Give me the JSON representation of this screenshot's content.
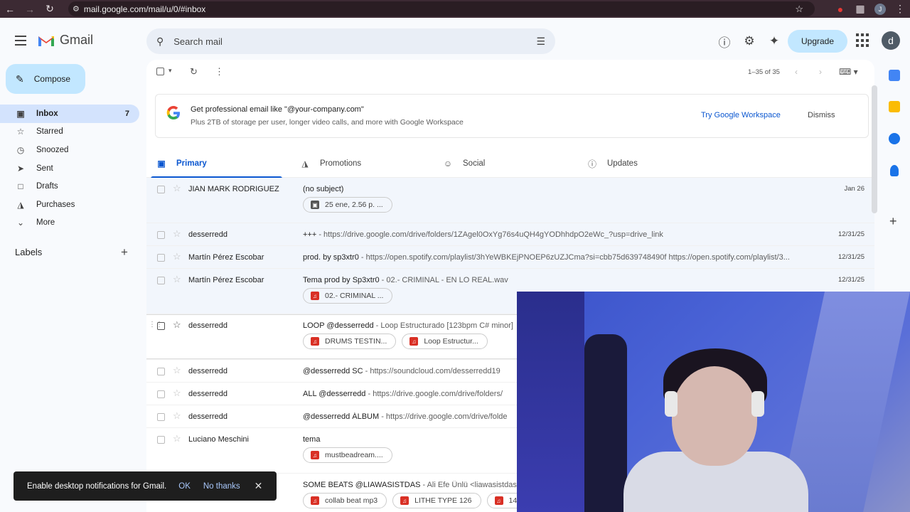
{
  "browser": {
    "url": "mail.google.com/mail/u/0/#inbox",
    "avatar_letter": "J"
  },
  "header": {
    "logo_text": "Gmail",
    "search_placeholder": "Search mail",
    "upgrade_label": "Upgrade",
    "avatar_letter": "d"
  },
  "sidebar": {
    "compose_label": "Compose",
    "items": [
      {
        "label": "Inbox",
        "icon": "inbox-icon",
        "count": "7",
        "active": true
      },
      {
        "label": "Starred",
        "icon": "star-icon",
        "count": ""
      },
      {
        "label": "Snoozed",
        "icon": "clock-icon",
        "count": ""
      },
      {
        "label": "Sent",
        "icon": "send-icon",
        "count": ""
      },
      {
        "label": "Drafts",
        "icon": "draft-icon",
        "count": ""
      },
      {
        "label": "Purchases",
        "icon": "tag-icon",
        "count": ""
      },
      {
        "label": "More",
        "icon": "chevron-down-icon",
        "count": ""
      }
    ],
    "labels_header": "Labels"
  },
  "toolbar": {
    "pager_text": "1–35 of 35"
  },
  "promo": {
    "title": "Get professional email like \"@your-company.com\"",
    "subtitle": "Plus 2TB of storage per user, longer video calls, and more with Google Workspace",
    "cta": "Try Google Workspace",
    "dismiss": "Dismiss"
  },
  "tabs": [
    {
      "label": "Primary",
      "icon": "inbox-tab-icon"
    },
    {
      "label": "Promotions",
      "icon": "tag-icon"
    },
    {
      "label": "Social",
      "icon": "people-icon"
    },
    {
      "label": "Updates",
      "icon": "info-icon"
    }
  ],
  "emails": [
    {
      "sender": "JIAN MARK RODRIGUEZ",
      "subject": "(no subject)",
      "snippet": "",
      "date": "Jan 26",
      "chips": [
        "25 ene, 2.56 p. ..."
      ]
    },
    {
      "sender": "desserredd",
      "subject": "+++",
      "snippet": " - https://drive.google.com/drive/folders/1ZAgel0OxYg76s4uQH4gYODhhdpO2eWc_?usp=drive_link",
      "date": "12/31/25",
      "chips": []
    },
    {
      "sender": "Martín Pérez Escobar",
      "subject": "prod. by sp3xtr0",
      "snippet": " - https://open.spotify.com/playlist/3hYeWBKEjPNOEP6zUZJCma?si=cbb75d639748490f https://open.spotify.com/playlist/3...",
      "date": "12/31/25",
      "chips": []
    },
    {
      "sender": "Martín Pérez Escobar",
      "subject": "Tema prod by Sp3xtr0",
      "snippet": " - 02.- CRIMINAL - EN LO REAL.wav",
      "date": "12/31/25",
      "chips": [
        "02.- CRIMINAL ..."
      ]
    },
    {
      "sender": "desserredd",
      "subject": "LOOP @desserredd",
      "snippet": " - Loop Estructurado [123bpm C# minor]",
      "date": "",
      "chips": [
        "DRUMS TESTIN...",
        "Loop Estructur..."
      ]
    },
    {
      "sender": "desserredd",
      "subject": "@desserredd SC",
      "snippet": " - https://soundcloud.com/desserredd19",
      "date": "",
      "chips": []
    },
    {
      "sender": "desserredd",
      "subject": "ALL @desserredd",
      "snippet": " - https://drive.google.com/drive/folders/",
      "date": "",
      "chips": []
    },
    {
      "sender": "desserredd",
      "subject": "@desserredd ÁLBUM",
      "snippet": " - https://drive.google.com/drive/folde",
      "date": "",
      "chips": []
    },
    {
      "sender": "Luciano Meschini",
      "subject": "tema",
      "snippet": "",
      "date": "",
      "chips": [
        "mustbeadream...."
      ]
    },
    {
      "sender": "",
      "subject": "SOME BEATS @LIAWASISTDAS",
      "snippet": " - Ali Efe Ünlü <liawasistdas@",
      "date": "",
      "chips": [
        "collab beat mp3",
        "LITHE TYPE 126",
        "14"
      ]
    }
  ],
  "toast": {
    "message": "Enable desktop notifications for Gmail.",
    "ok": "OK",
    "no_thanks": "No thanks"
  },
  "colors": {
    "accent": "#0b57d0",
    "compose_bg": "#c2e7ff",
    "active_nav_bg": "#d3e3fd",
    "browser_bar": "#3c2a33"
  }
}
